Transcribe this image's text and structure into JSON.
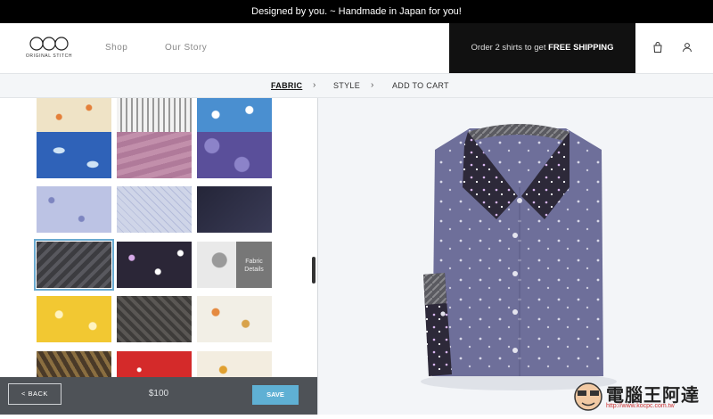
{
  "announcement": "Designed by you. ~ Handmade in Japan for you!",
  "brand": {
    "logo_text": "ORIGINAL STITCH"
  },
  "nav": {
    "shop": "Shop",
    "our_story": "Our Story"
  },
  "promo": {
    "prefix": "Order 2 shirts to get",
    "highlight": "FREE SHIPPING"
  },
  "steps": {
    "fabric": "FABRIC",
    "style": "STYLE",
    "add_to_cart": "ADD TO CART"
  },
  "fabric_details": "Fabric Details",
  "footer": {
    "back": "< BACK",
    "price": "$100",
    "save": "SAVE"
  },
  "watermark": {
    "text": "電腦王阿達",
    "url": "http://www.kocpc.com.tw"
  },
  "colors": {
    "accent": "#5fb0d4",
    "footer_bg": "#4e5257",
    "promo_bg": "#111111",
    "shirt": "#6e6f9a",
    "shirt_dark": "#2d2939"
  },
  "icons": [
    "bag-icon",
    "user-icon",
    "chevron-right-icon"
  ]
}
